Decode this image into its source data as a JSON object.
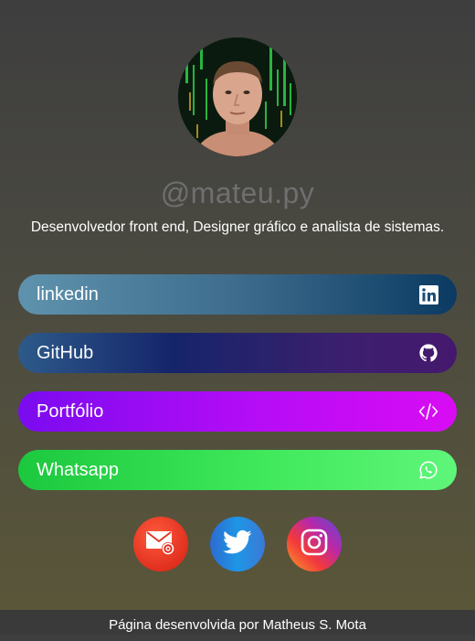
{
  "profile": {
    "handle": "@mateu.py",
    "bio": "Desenvolvedor front end, Designer gráfico e analista de sistemas."
  },
  "links": [
    {
      "label": "linkedin",
      "icon": "linkedin-icon",
      "colors": [
        "#5f93ad",
        "#0b3a62"
      ]
    },
    {
      "label": "GitHub",
      "icon": "github-icon",
      "colors": [
        "#2d5a8a",
        "#45186e"
      ]
    },
    {
      "label": "Portfólio",
      "icon": "code-icon",
      "colors": [
        "#7a0bf0",
        "#d90cf4"
      ]
    },
    {
      "label": "Whatsapp",
      "icon": "whatsapp-icon",
      "colors": [
        "#1cc83e",
        "#5ff67a"
      ]
    }
  ],
  "social": [
    {
      "icon": "email-icon",
      "color": "#e0301f"
    },
    {
      "icon": "twitter-icon",
      "color": "#1e96e6"
    },
    {
      "icon": "instagram-icon",
      "color": "#f3393b"
    }
  ],
  "footer": {
    "text": "Página desenvolvida por Matheus S. Mota"
  }
}
